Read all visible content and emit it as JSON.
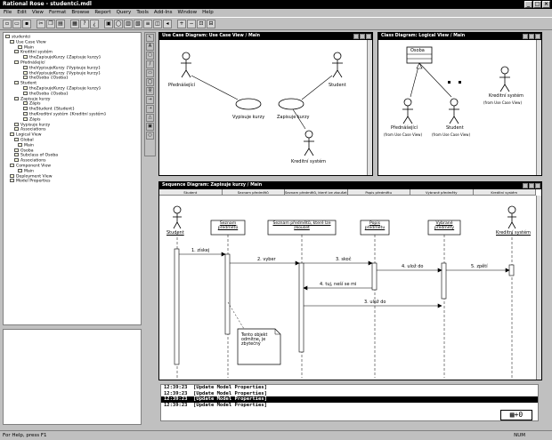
{
  "window": {
    "title": "Rational Rose - studentci.mdl"
  },
  "menu": [
    "File",
    "Edit",
    "View",
    "Format",
    "Browse",
    "Report",
    "Query",
    "Tools",
    "Add-Ins",
    "Window",
    "Help"
  ],
  "tree": {
    "root": "studentci",
    "use_case_view": "Use Case View",
    "main": "Main",
    "kredit": "Kreditní systém",
    "kredit_sub": "theZapisujeKurzy {Zapisuje kurzy}",
    "prednasejici": "Přednášející",
    "p1": "theVypisujeKurzy {Vypisuje kurzy}",
    "p2": "theVypisujeKurzy {Vypisuje kurzy}",
    "p3": "theOsoba {Osoba}",
    "student": "Student",
    "s1": "theZapisujeKurzy {Zapisuje kurzy}",
    "s2": "theOsoba {Osoba}",
    "zapisuje": "Zapisuje kurzy",
    "z1": "Zápis",
    "z2": "theStudent {Student}",
    "z3": "theKreditní systém {Kreditní systém}",
    "z4": "Zápis",
    "vypisuje": "Vypisuje kurzy",
    "assoc": "Associations",
    "logical": "Logical View",
    "global": "Global",
    "osoba": "Osoba",
    "subclass": "Subclass of Osoba",
    "component_view": "Component View",
    "component_main": "Main",
    "deployment": "Deployment View",
    "props": "Model Properties"
  },
  "uc": {
    "title": "Use Case Diagram: Use Case View / Main",
    "actor1": "Přednášející",
    "actor2": "Student",
    "actor3": "Kreditní systém",
    "case1": "Vypisuje kurzy",
    "case2": "Zapisuje kurzy"
  },
  "cls": {
    "title": "Class Diagram: Logical View / Main",
    "osoba": "Osoba",
    "actor1": "Přednášející",
    "actor1sub": "(from Use Case View)",
    "actor2": "Student",
    "actor2sub": "(from Use Case View)",
    "actor3": "Kreditní systém",
    "actor3sub": "(from Use Case View)"
  },
  "seq": {
    "title": "Sequence Diagram: Zapisuje kurzy / Main",
    "cols": [
      "Student",
      "Seznam předmětů",
      "Seznam předmětů, které lze zkoušet",
      "Popis předmětu",
      "Vybrané předměty",
      "Kreditní systém"
    ],
    "o1": "Student",
    "o2": "Seznam předmětů",
    "o3": "Seznam předmětů, které lze zkoušet",
    "o4": "Popis předmětu",
    "o5": "Vybrané předměty",
    "o6": "Kreditní systém",
    "m1": "1. získej",
    "m2": "2. vyber",
    "m3": "3. skoč",
    "m4": "4. ulož do",
    "m5": "4. tuj, neší se mi",
    "m6": "5. zpětí",
    "m7": "3. ulož do",
    "note": "Tento objekt odmítne, je zbytečný"
  },
  "log": [
    {
      "t": "12:39:23",
      "m": "[Update Model Properties]"
    },
    {
      "t": "12:39:23",
      "m": "[Update Model Properties]"
    },
    {
      "t": "12:39:23",
      "m": "[Update Model Properties]"
    },
    {
      "t": "12:39:23",
      "m": "[Update Model Properties]"
    }
  ],
  "status": {
    "left": "For Help, press F1",
    "right": "NUM"
  }
}
